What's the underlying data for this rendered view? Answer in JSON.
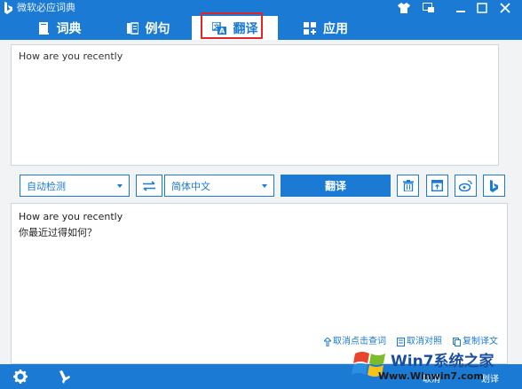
{
  "window": {
    "title": "微软必应词典"
  },
  "tabs": [
    {
      "label": "词典",
      "icon": "book-icon"
    },
    {
      "label": "例句",
      "icon": "sentences-icon"
    },
    {
      "label": "翻译",
      "icon": "translate-icon",
      "active": true
    },
    {
      "label": "应用",
      "icon": "apps-icon"
    }
  ],
  "input": {
    "text": "How are you recently"
  },
  "controls": {
    "source_lang": "自动检测",
    "target_lang": "简体中文",
    "translate_label": "翻译"
  },
  "output": {
    "source_text": "How are you recently",
    "translated_text": "你最近过得如何？",
    "actions": {
      "cancel_click_lookup": "取消点击查词",
      "cancel_compare": "取消对照",
      "copy_translation": "复制译文"
    }
  },
  "bottom": {
    "cancel": "取消",
    "scratch": "划译"
  },
  "watermark": {
    "brand": "Win7系统之家",
    "url": "Www.Winwin7.com"
  },
  "colors": {
    "accent": "#1a7ad4",
    "highlight_border": "#e0252a",
    "panel_bg": "#f1f3f5"
  }
}
